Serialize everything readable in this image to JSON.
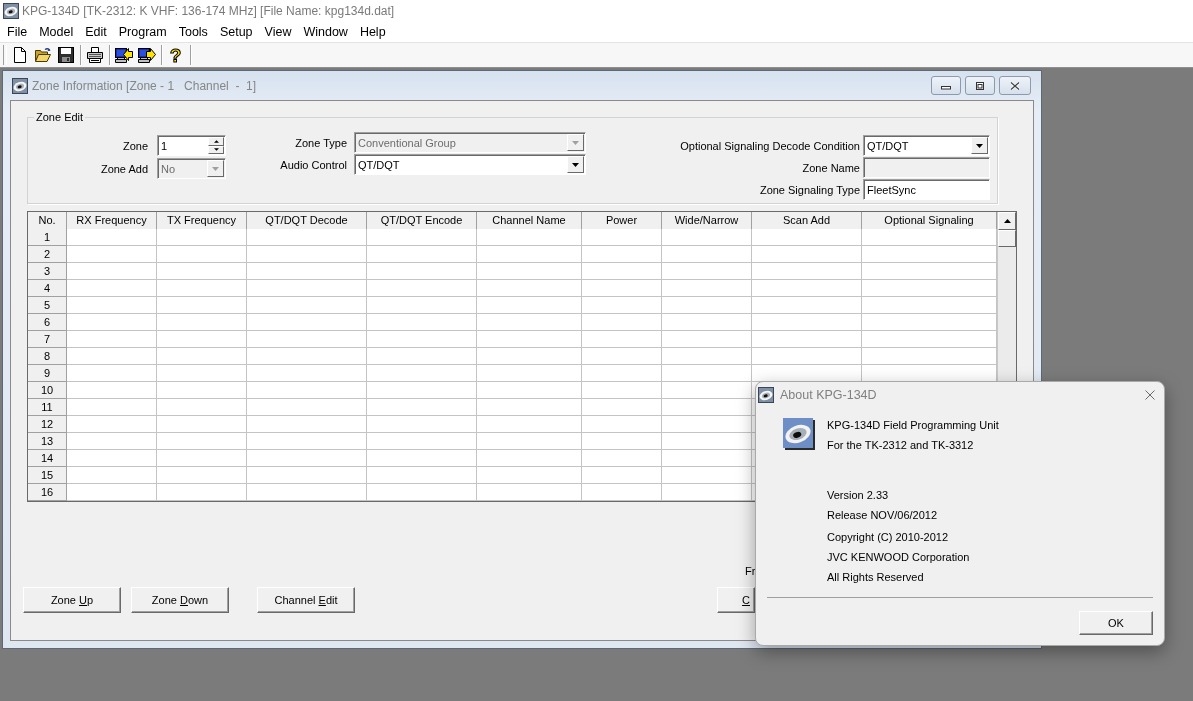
{
  "title_bar": {
    "title": "KPG-134D [TK-2312: K VHF: 136-174 MHz] [File Name: kpg134d.dat]"
  },
  "menu": [
    "File",
    "Model",
    "Edit",
    "Program",
    "Tools",
    "Setup",
    "View",
    "Window",
    "Help"
  ],
  "toolbar": {
    "help_glyph": "?"
  },
  "zone_window": {
    "title": "Zone Information [Zone - 1   Channel  -  1]",
    "zone_edit": {
      "title": "Zone Edit",
      "field_groups": [
        {
          "fields": [
            {
              "label": "Zone",
              "kind": "spin",
              "value": "1",
              "disabled": false
            },
            {
              "label": "Zone Add",
              "kind": "combo",
              "value": "No",
              "disabled": true
            }
          ]
        },
        {
          "fields": [
            {
              "label": "Zone Type",
              "kind": "combo",
              "value": "Conventional Group",
              "disabled": true
            },
            {
              "label": "Audio Control",
              "kind": "combo",
              "value": "QT/DQT",
              "disabled": false
            }
          ]
        },
        {
          "fields": [
            {
              "label": "Optional Signaling Decode Condition",
              "kind": "combo",
              "value": "QT/DQT",
              "disabled": false
            },
            {
              "label": "Zone Name",
              "kind": "text",
              "disabled": true
            },
            {
              "label": "Zone Signaling Type",
              "kind": "text",
              "value": "FleetSync",
              "disabled": false
            }
          ]
        }
      ]
    },
    "table": {
      "columns": [
        "No.",
        "RX Frequency",
        "TX Frequency",
        "QT/DQT Decode",
        "QT/DQT Encode",
        "Channel Name",
        "Power",
        "Wide/Narrow",
        "Scan Add",
        "Optional Signaling"
      ],
      "rows": [
        {
          "no": "1"
        },
        {
          "no": "2"
        },
        {
          "no": "3"
        },
        {
          "no": "4"
        },
        {
          "no": "5"
        },
        {
          "no": "6"
        },
        {
          "no": "7"
        },
        {
          "no": "8"
        },
        {
          "no": "9"
        },
        {
          "no": "10"
        },
        {
          "no": "11"
        },
        {
          "no": "12"
        },
        {
          "no": "13"
        },
        {
          "no": "14"
        },
        {
          "no": "15"
        },
        {
          "no": "16"
        }
      ]
    },
    "cut_off_label": "Fr",
    "buttons": [
      {
        "before": "Zone ",
        "key": "U",
        "after": "p"
      },
      {
        "before": "Zone ",
        "key": "D",
        "after": "own"
      },
      {
        "before": "Channel ",
        "key": "E",
        "after": "dit"
      }
    ],
    "cut_off_button": {
      "key": "C"
    }
  },
  "about_dialog": {
    "title": "About KPG-134D",
    "line_groups": [
      {
        "lines": [
          "KPG-134D Field Programming Unit",
          "For the TK-2312 and TK-3312"
        ]
      },
      {
        "lines": [
          "Version 2.33",
          "Release NOV/06/2012"
        ]
      },
      {
        "lines": [
          "Copyright (C) 2010-2012",
          "JVC KENWOOD Corporation",
          "All Rights Reserved"
        ]
      }
    ],
    "ok_button": "OK"
  }
}
